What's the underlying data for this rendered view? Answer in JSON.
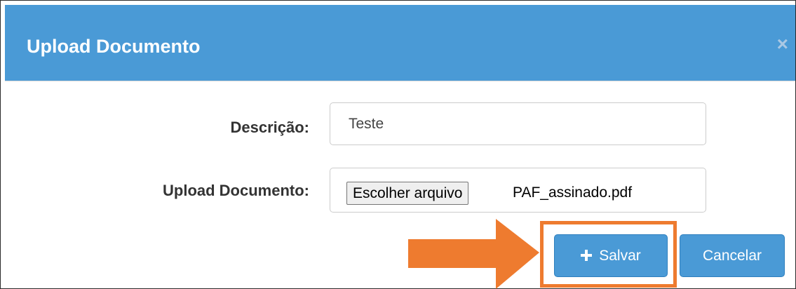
{
  "modal": {
    "title": "Upload Documento",
    "close_symbol": "×"
  },
  "form": {
    "description_label": "Descrição:",
    "description_value": "Teste",
    "upload_label": "Upload Documento:",
    "choose_file_label": "Escolher arquivo",
    "file_name": "PAF_assinado.pdf"
  },
  "buttons": {
    "save_label": "Salvar",
    "save_icon": "plus-icon",
    "cancel_label": "Cancelar"
  },
  "annotation": {
    "arrow_color": "#ee7b2f",
    "highlight_color": "#ee7b2f"
  },
  "colors": {
    "header": "#4a9ad6",
    "button": "#4a9ad6"
  }
}
